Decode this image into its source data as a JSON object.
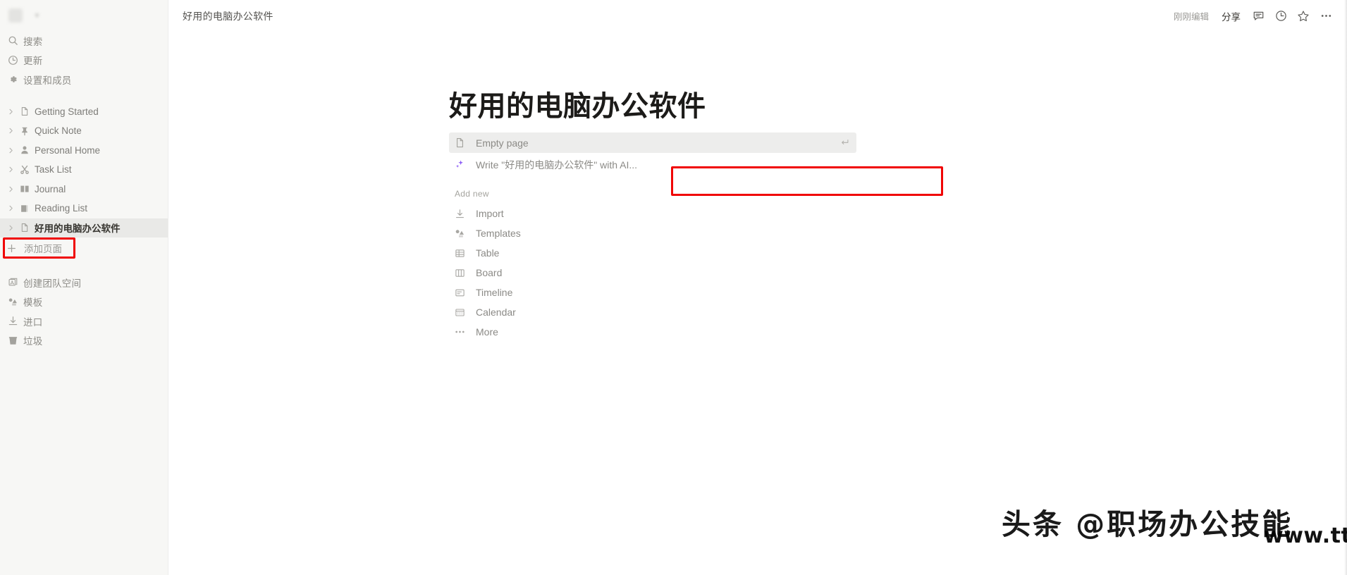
{
  "sidebar": {
    "workspace": {
      "name": "",
      "chevron_icon": "chevron-down-icon",
      "avatar_icon": "workspace-avatar"
    },
    "quick_actions": [
      {
        "label": "搜索",
        "icon": "search-icon"
      },
      {
        "label": "更新",
        "icon": "clock-update-icon"
      },
      {
        "label": "设置和成员",
        "icon": "gear-icon"
      }
    ],
    "pages": [
      {
        "label": "Getting Started",
        "icon": "document-icon",
        "selected": false
      },
      {
        "label": "Quick Note",
        "icon": "pin-icon",
        "selected": false
      },
      {
        "label": "Personal Home",
        "icon": "person-icon",
        "selected": false
      },
      {
        "label": "Task List",
        "icon": "scissors-icon",
        "selected": false
      },
      {
        "label": "Journal",
        "icon": "open-book-icon",
        "selected": false
      },
      {
        "label": "Reading List",
        "icon": "books-icon",
        "selected": false
      },
      {
        "label": "好用的电脑办公软件",
        "icon": "document-icon",
        "selected": true
      }
    ],
    "add_page": {
      "label": "添加页面",
      "icon": "plus-icon"
    },
    "bottom_actions": [
      {
        "label": "创建团队空间",
        "icon": "teamspace-icon"
      },
      {
        "label": "模板",
        "icon": "templates-icon"
      },
      {
        "label": "进口",
        "icon": "import-icon"
      },
      {
        "label": "垃圾",
        "icon": "trash-icon"
      }
    ]
  },
  "topbar": {
    "breadcrumb": "好用的电脑办公软件",
    "edited_label": "刚刚编辑",
    "share_label": "分享",
    "icons": [
      {
        "name": "comment-icon"
      },
      {
        "name": "clock-history-icon"
      },
      {
        "name": "star-icon"
      },
      {
        "name": "more-horizontal-icon"
      }
    ]
  },
  "main": {
    "page_title": "好用的电脑办公软件",
    "options": [
      {
        "label": "Empty page",
        "icon": "document-icon",
        "highlighted": true,
        "enter_icon": "enter-return-icon"
      }
    ],
    "ai_option": {
      "label": "Write \"好用的电脑办公软件\" with AI...",
      "icon": "ai-sparkle-icon"
    },
    "add_new_heading": "Add new",
    "add_new_items": [
      {
        "label": "Import",
        "icon": "import-arrow-icon"
      },
      {
        "label": "Templates",
        "icon": "templates-icon"
      },
      {
        "label": "Table",
        "icon": "table-icon"
      },
      {
        "label": "Board",
        "icon": "board-icon"
      },
      {
        "label": "Timeline",
        "icon": "timeline-icon"
      },
      {
        "label": "Calendar",
        "icon": "calendar-icon"
      },
      {
        "label": "More",
        "icon": "more-horizontal-icon"
      }
    ]
  },
  "watermarks": {
    "primary": "头条 @职场办公技能",
    "secondary": "www.tttjj.cn软件老网"
  },
  "colors": {
    "sidebar_bg": "#f7f7f5",
    "selected_row": "#e9e9e7",
    "annotation_red": "#f00505",
    "ai_purple": "#8b5cf6",
    "text_primary": "#373530",
    "text_muted": "#8b8a86"
  }
}
